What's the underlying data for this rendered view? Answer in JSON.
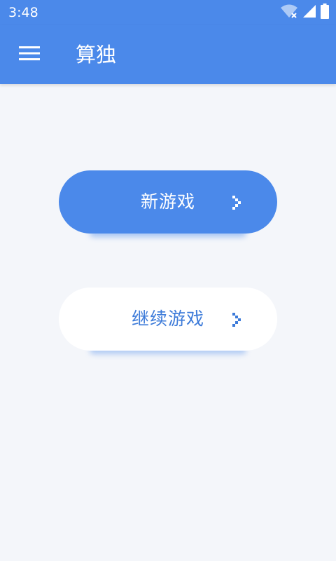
{
  "status_bar": {
    "time": "3:48",
    "icons": [
      "wifi-off-icon",
      "cell-signal-icon",
      "battery-icon"
    ]
  },
  "app_bar": {
    "title": "算独",
    "menu_icon": "menu-icon"
  },
  "actions": {
    "new_game_label": "新游戏",
    "continue_game_label": "继续游戏",
    "arrow_icon": "chevron-right-icon"
  },
  "colors": {
    "primary": "#4b89ea",
    "background": "#f4f6fa",
    "secondary_text": "#3d7bd9"
  }
}
